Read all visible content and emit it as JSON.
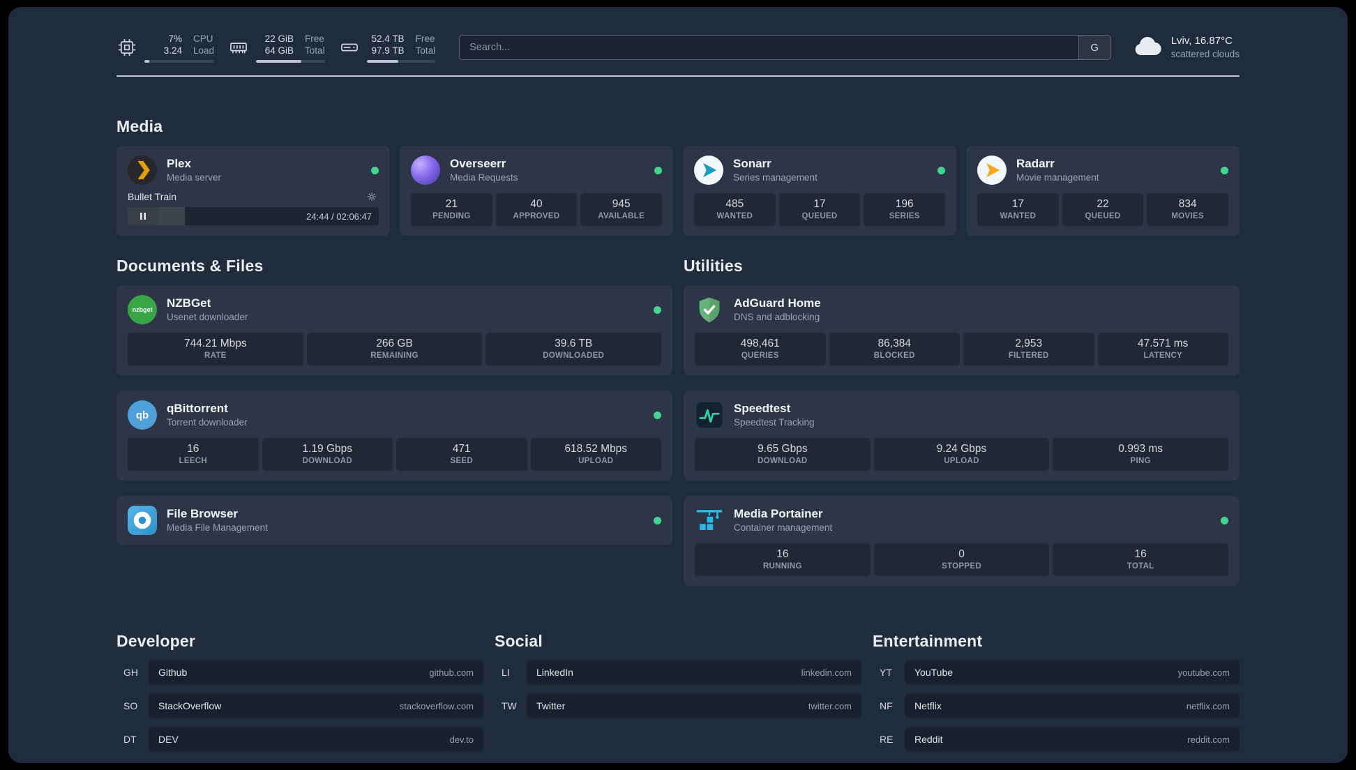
{
  "topbar": {
    "resources": [
      {
        "icon": "cpu-icon",
        "rows": [
          {
            "value": "7%",
            "label": "CPU"
          },
          {
            "value": "3.24",
            "label": "Load"
          }
        ],
        "progress": 7
      },
      {
        "icon": "memory-icon",
        "rows": [
          {
            "value": "22 GiB",
            "label": "Free"
          },
          {
            "value": "64 GiB",
            "label": "Total"
          }
        ],
        "progress": 66
      },
      {
        "icon": "disk-icon",
        "rows": [
          {
            "value": "52.4 TB",
            "label": "Free"
          },
          {
            "value": "97.9 TB",
            "label": "Total"
          }
        ],
        "progress": 46
      }
    ],
    "search": {
      "placeholder": "Search...",
      "provider_button": "G"
    },
    "weather": {
      "location": "Lviv, 16.87°C",
      "condition": "scattered clouds"
    }
  },
  "sections": {
    "media": {
      "title": "Media"
    },
    "documents": {
      "title": "Documents & Files"
    },
    "utilities": {
      "title": "Utilities"
    }
  },
  "colors": {
    "status_online": "#44d58c",
    "plex_accent": "#e5a00d",
    "sonarr_accent": "#1b9dc4",
    "radarr_accent": "#f5a623",
    "adguard_green": "#67b279",
    "speedtest_green": "#2dd4a7",
    "portainer_blue": "#29b8e5"
  },
  "services": {
    "plex": {
      "name": "Plex",
      "subtitle": "Media server",
      "online": true,
      "player": {
        "track": "Bullet Train",
        "time": "24:44 / 02:06:47",
        "progress": 19
      }
    },
    "overseerr": {
      "name": "Overseerr",
      "subtitle": "Media Requests",
      "online": true,
      "stats": [
        {
          "value": "21",
          "label": "PENDING"
        },
        {
          "value": "40",
          "label": "APPROVED"
        },
        {
          "value": "945",
          "label": "AVAILABLE"
        }
      ]
    },
    "sonarr": {
      "name": "Sonarr",
      "subtitle": "Series management",
      "online": true,
      "stats": [
        {
          "value": "485",
          "label": "WANTED"
        },
        {
          "value": "17",
          "label": "QUEUED"
        },
        {
          "value": "196",
          "label": "SERIES"
        }
      ]
    },
    "radarr": {
      "name": "Radarr",
      "subtitle": "Movie management",
      "online": true,
      "stats": [
        {
          "value": "17",
          "label": "WANTED"
        },
        {
          "value": "22",
          "label": "QUEUED"
        },
        {
          "value": "834",
          "label": "MOVIES"
        }
      ]
    },
    "nzbget": {
      "name": "NZBGet",
      "subtitle": "Usenet downloader",
      "online": true,
      "icon_text": "nzbget",
      "stats": [
        {
          "value": "744.21 Mbps",
          "label": "RATE"
        },
        {
          "value": "266 GB",
          "label": "REMAINING"
        },
        {
          "value": "39.6 TB",
          "label": "DOWNLOADED"
        }
      ]
    },
    "qbittorrent": {
      "name": "qBittorrent",
      "subtitle": "Torrent downloader",
      "online": true,
      "icon_text": "qb",
      "stats": [
        {
          "value": "16",
          "label": "LEECH"
        },
        {
          "value": "1.19 Gbps",
          "label": "DOWNLOAD"
        },
        {
          "value": "471",
          "label": "SEED"
        },
        {
          "value": "618.52 Mbps",
          "label": "UPLOAD"
        }
      ]
    },
    "filebrowser": {
      "name": "File Browser",
      "subtitle": "Media File Management",
      "online": true
    },
    "adguard": {
      "name": "AdGuard Home",
      "subtitle": "DNS and adblocking",
      "online": false,
      "stats": [
        {
          "value": "498,461",
          "label": "QUERIES"
        },
        {
          "value": "86,384",
          "label": "BLOCKED"
        },
        {
          "value": "2,953",
          "label": "FILTERED"
        },
        {
          "value": "47.571 ms",
          "label": "LATENCY"
        }
      ]
    },
    "speedtest": {
      "name": "Speedtest",
      "subtitle": "Speedtest Tracking",
      "online": false,
      "stats": [
        {
          "value": "9.65 Gbps",
          "label": "DOWNLOAD"
        },
        {
          "value": "9.24 Gbps",
          "label": "UPLOAD"
        },
        {
          "value": "0.993 ms",
          "label": "PING"
        }
      ]
    },
    "portainer": {
      "name": "Media Portainer",
      "subtitle": "Container management",
      "online": true,
      "stats": [
        {
          "value": "16",
          "label": "RUNNING"
        },
        {
          "value": "0",
          "label": "STOPPED"
        },
        {
          "value": "16",
          "label": "TOTAL"
        }
      ]
    }
  },
  "bookmarks": [
    {
      "title": "Developer",
      "items": [
        {
          "abbr": "GH",
          "name": "Github",
          "url": "github.com"
        },
        {
          "abbr": "SO",
          "name": "StackOverflow",
          "url": "stackoverflow.com"
        },
        {
          "abbr": "DT",
          "name": "DEV",
          "url": "dev.to"
        }
      ]
    },
    {
      "title": "Social",
      "items": [
        {
          "abbr": "LI",
          "name": "LinkedIn",
          "url": "linkedin.com"
        },
        {
          "abbr": "TW",
          "name": "Twitter",
          "url": "twitter.com"
        }
      ]
    },
    {
      "title": "Entertainment",
      "items": [
        {
          "abbr": "YT",
          "name": "YouTube",
          "url": "youtube.com"
        },
        {
          "abbr": "NF",
          "name": "Netflix",
          "url": "netflix.com"
        },
        {
          "abbr": "RE",
          "name": "Reddit",
          "url": "reddit.com"
        }
      ]
    }
  ]
}
